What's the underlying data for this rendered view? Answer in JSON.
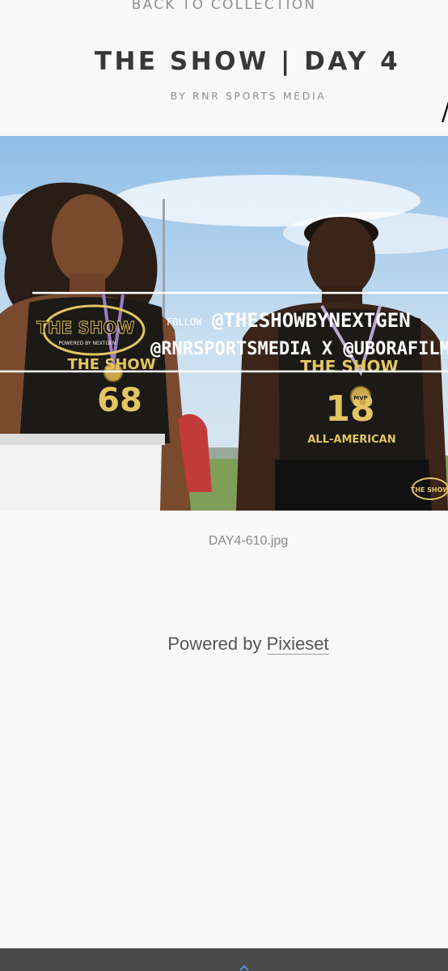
{
  "header": {
    "back_link": "BACK TO COLLECTION",
    "title": "THE SHOW | DAY 4",
    "byline": "BY RNR SPORTS MEDIA",
    "edge_glyph": "/"
  },
  "photo": {
    "alt": "Two football players in black and gold jerseys wearing MVP medals",
    "overlay": {
      "follow_label": "FOLLOW",
      "handle_primary": "@THESHOWBYNEXTGEN",
      "handle_secondary": "@RNRSPORTSMEDIA X @UBORAFILMS",
      "logo_text": "THE SHOW",
      "logo_subtext": "POWERED BY NEXTGEN"
    },
    "jersey_left": {
      "number": "68",
      "text": "THE SHOW"
    },
    "jersey_right": {
      "number": "18",
      "text": "THE SHOW",
      "subtext": "ALL-AMERICAN"
    },
    "medal_text": "MVP",
    "corner_logo": "THE SHOW",
    "colors": {
      "sky": "#9cc6ea",
      "jersey": "#1c1a17",
      "gold": "#e3c562",
      "shorts": "#f2f2f2"
    }
  },
  "filename": "DAY4-610.jpg",
  "footer": {
    "powered_prefix": "Powered by",
    "powered_link": "Pixieset"
  },
  "bottom_bar": {
    "icon": "chevron-up-icon",
    "accent": "#5b8fd6"
  }
}
